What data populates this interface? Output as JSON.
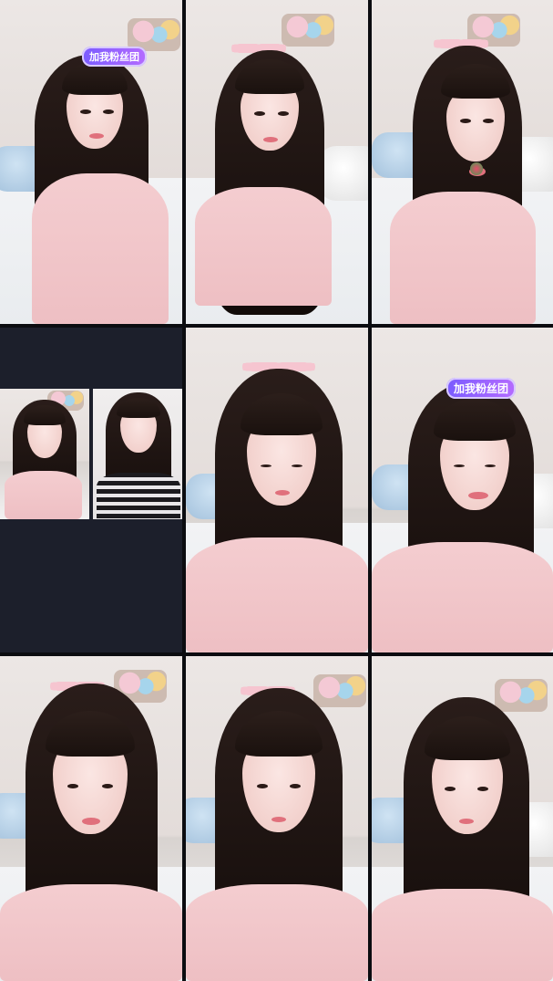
{
  "badge_text": "加我粉丝团",
  "colors": {
    "background": "#0b0c10",
    "split_panel": "#1c1f2b",
    "badge": "#8a5cff",
    "shirt": "#f4cdd0"
  },
  "cells": [
    {
      "id": "r1c1",
      "badge": true
    },
    {
      "id": "r1c2",
      "badge": false
    },
    {
      "id": "r1c3",
      "badge": false,
      "prop": "lollipop"
    },
    {
      "id": "r2c1",
      "layout": "split-call"
    },
    {
      "id": "r2c2",
      "badge": false
    },
    {
      "id": "r2c3",
      "badge": true
    },
    {
      "id": "r3c1",
      "badge": false
    },
    {
      "id": "r3c2",
      "badge": false
    },
    {
      "id": "r3c3",
      "badge": false
    }
  ]
}
